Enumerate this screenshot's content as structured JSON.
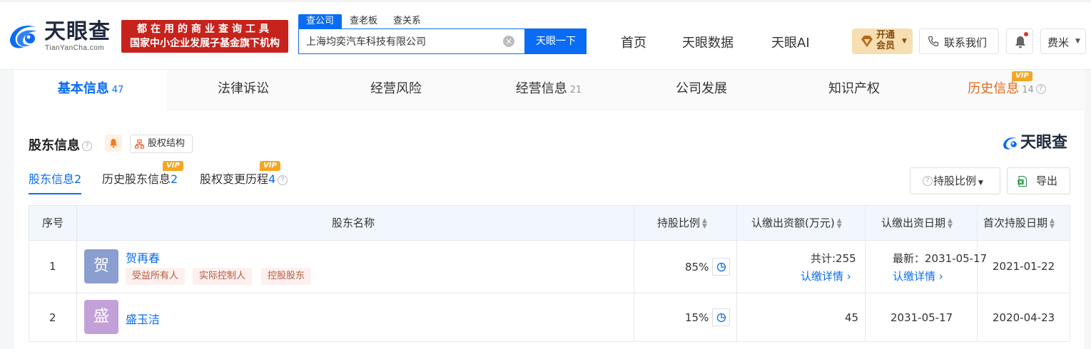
{
  "header": {
    "logo_cn": "天眼查",
    "logo_en": "TianYanCha.com",
    "slogan_line1": "都在用的商业查询工具",
    "slogan_line2": "国家中小企业发展子基金旗下机构",
    "search_tabs": [
      "查公司",
      "查老板",
      "查关系"
    ],
    "search_value": "上海均奕汽车科技有限公司",
    "search_button": "天眼一下",
    "nav": [
      "首页",
      "天眼数据",
      "天眼AI"
    ],
    "vip_line1": "开通",
    "vip_line2": "会员",
    "contact": "联系我们",
    "user": "费米",
    "brand_color": "#0a6cf5"
  },
  "main_tabs": [
    {
      "label": "基本信息",
      "count": "47"
    },
    {
      "label": "法律诉讼",
      "count": ""
    },
    {
      "label": "经营风险",
      "count": ""
    },
    {
      "label": "经营信息",
      "count": "21"
    },
    {
      "label": "公司发展",
      "count": ""
    },
    {
      "label": "知识产权",
      "count": ""
    },
    {
      "label": "历史信息",
      "count": "14",
      "vip": "VIP"
    }
  ],
  "section": {
    "title": "股东信息",
    "structure_button": "股权结构",
    "brand": "天眼查",
    "sub_tabs": [
      {
        "label": "股东信息",
        "count": "2"
      },
      {
        "label": "历史股东信息",
        "count": "2",
        "vip": "VIP"
      },
      {
        "label": "股权变更历程",
        "count": "4",
        "vip": "VIP"
      }
    ],
    "ratio_button": "持股比例",
    "export_button": "导出"
  },
  "table": {
    "headers": [
      "序号",
      "股东名称",
      "持股比例",
      "认缴出资额(万元)",
      "认缴出资日期",
      "首次持股日期"
    ],
    "rows": [
      {
        "index": "1",
        "avatar": "贺",
        "name": "贺再春",
        "tags": [
          "受益所有人",
          "实际控制人",
          "控股股东"
        ],
        "ratio": "85%",
        "amount": "共计:255",
        "amount_link": "认缴详情",
        "date": "最新：2031-05-17",
        "date_link": "认缴详情",
        "first_date": "2021-01-22"
      },
      {
        "index": "2",
        "avatar": "盛",
        "name": "盛玉洁",
        "tags": [],
        "ratio": "15%",
        "amount": "45",
        "date": "2031-05-17",
        "first_date": "2020-04-23"
      }
    ]
  }
}
